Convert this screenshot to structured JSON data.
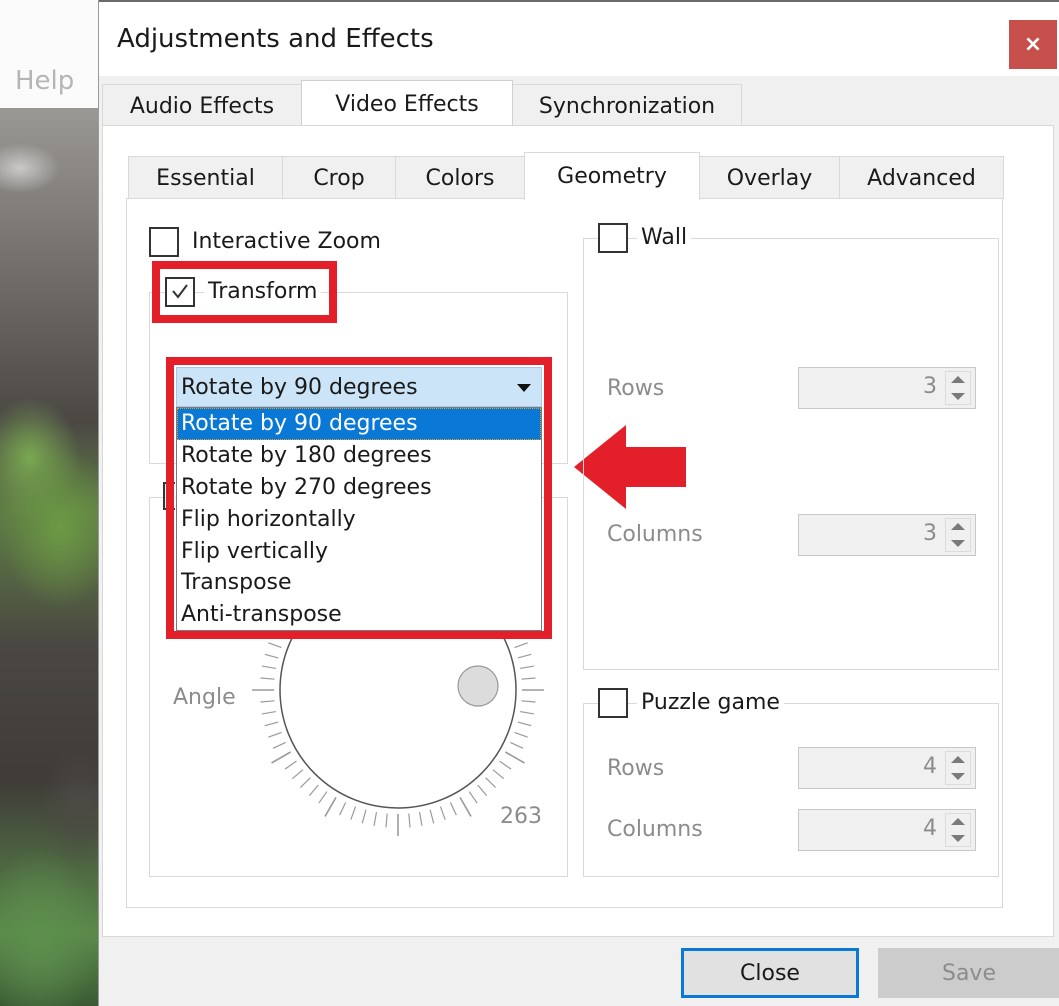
{
  "background_app": {
    "menu_item": "Help"
  },
  "dialog": {
    "title": "Adjustments and Effects",
    "close_icon": "×",
    "tabs": [
      {
        "label": "Audio Effects",
        "active": false
      },
      {
        "label": "Video Effects",
        "active": true
      },
      {
        "label": "Synchronization",
        "active": false
      }
    ],
    "subtabs": [
      {
        "label": "Essential",
        "active": false
      },
      {
        "label": "Crop",
        "active": false
      },
      {
        "label": "Colors",
        "active": false
      },
      {
        "label": "Geometry",
        "active": true
      },
      {
        "label": "Overlay",
        "active": false
      },
      {
        "label": "Advanced",
        "active": false
      }
    ],
    "geometry": {
      "interactive_zoom": {
        "label": "Interactive Zoom",
        "checked": false
      },
      "transform": {
        "label": "Transform",
        "checked": true,
        "selected": "Rotate by 90 degrees",
        "options": [
          "Rotate by 90 degrees",
          "Rotate by 180 degrees",
          "Rotate by 270 degrees",
          "Flip horizontally",
          "Flip vertically",
          "Transpose",
          "Anti-transpose"
        ],
        "highlighted_index": 0
      },
      "rotate": {
        "angle_label": "Angle",
        "angle_value": "263"
      },
      "wall": {
        "label": "Wall",
        "checked": false,
        "rows_label": "Rows",
        "rows_value": "3",
        "columns_label": "Columns",
        "columns_value": "3"
      },
      "puzzle": {
        "label": "Puzzle game",
        "checked": false,
        "rows_label": "Rows",
        "rows_value": "4",
        "columns_label": "Columns",
        "columns_value": "4"
      }
    },
    "buttons": {
      "close": "Close",
      "save": "Save"
    }
  },
  "annotations": {
    "highlight_color": "#e3202a",
    "arrow_direction": "left"
  }
}
